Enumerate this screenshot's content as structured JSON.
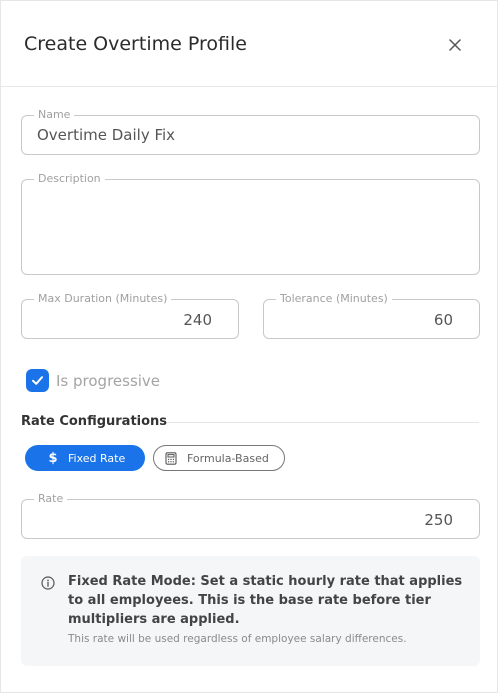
{
  "dialog": {
    "title": "Create Overtime Profile"
  },
  "form": {
    "name": {
      "label": "Name",
      "value": "Overtime Daily Fix"
    },
    "description": {
      "label": "Description",
      "value": ""
    },
    "max_duration": {
      "label": "Max Duration (Minutes)",
      "value": "240"
    },
    "tolerance": {
      "label": "Tolerance (Minutes)",
      "value": "60"
    },
    "is_progressive": {
      "label": "Is progressive",
      "checked": true
    }
  },
  "rate_configurations": {
    "title": "Rate Configurations",
    "modes": [
      {
        "label": "Fixed Rate",
        "icon": "dollar-icon",
        "active": true
      },
      {
        "label": "Formula-Based",
        "icon": "calculator-icon",
        "active": false
      }
    ],
    "rate": {
      "label": "Rate",
      "value": "250"
    }
  },
  "info": {
    "icon": "info-icon",
    "title": "Fixed Rate Mode: Set a static hourly rate that applies to all employees. This is the base rate before tier multipliers are applied.",
    "subtitle": "This rate will be used regardless of employee salary differences."
  },
  "colors": {
    "accent": "#1a73e8",
    "border": "#c9c9c9",
    "info_bg": "#f5f6f8"
  }
}
